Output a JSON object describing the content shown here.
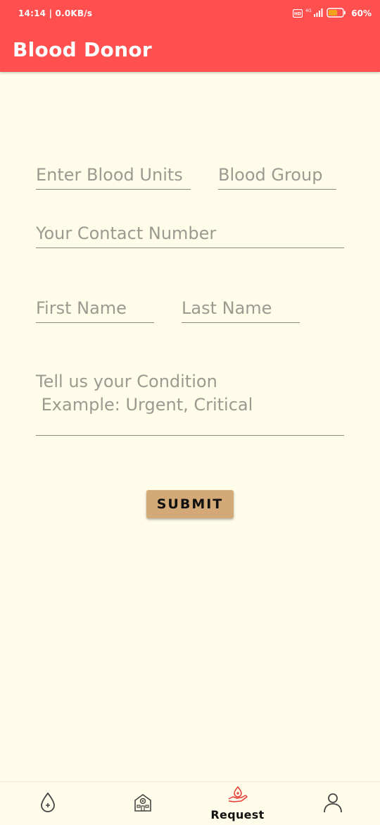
{
  "status_bar": {
    "time_speed": "14:14 | 0.0KB/s",
    "network": "4G",
    "battery": "60%"
  },
  "app_bar": {
    "title": "Blood Donor"
  },
  "form": {
    "blood_units_placeholder": "Enter Blood Units",
    "blood_group_placeholder": "Blood Group",
    "contact_placeholder": "Your Contact Number",
    "first_name_placeholder": "First Name",
    "last_name_placeholder": "Last Name",
    "condition_placeholder": "Tell us your Condition\n Example: Urgent, Critical",
    "submit_label": "SUBMIT"
  },
  "bottom_nav": {
    "items": [
      {
        "icon": "blood-drop-icon",
        "label": ""
      },
      {
        "icon": "hospital-icon",
        "label": ""
      },
      {
        "icon": "request-hand-icon",
        "label": "Request"
      },
      {
        "icon": "profile-icon",
        "label": ""
      }
    ],
    "active_index": 2
  },
  "colors": {
    "app_bar": "#FF4F4F",
    "background": "#FFFDE9",
    "submit": "#D2A977",
    "active_icon": "#E53935"
  }
}
